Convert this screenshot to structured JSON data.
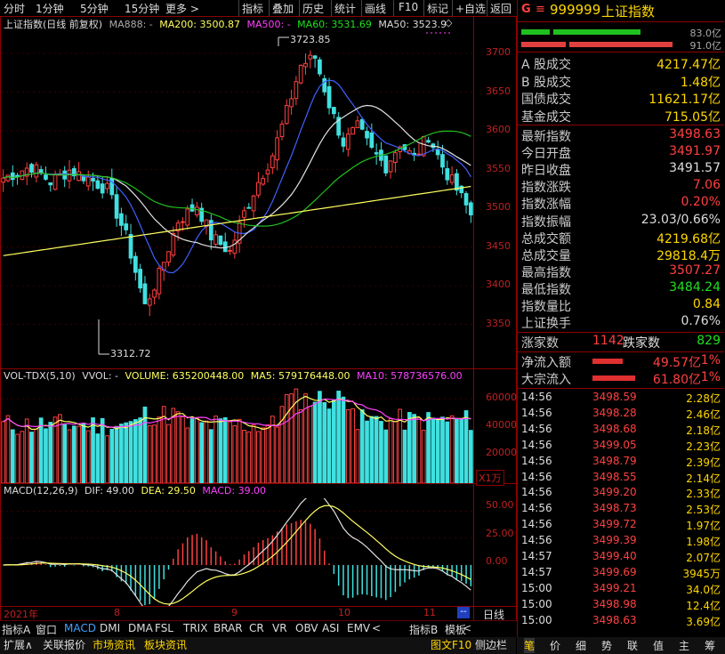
{
  "toolbar": {
    "left": [
      "分时",
      "1分钟",
      "5分钟",
      "15分钟",
      "更多 >"
    ],
    "right": [
      "指标",
      "叠加",
      "历史",
      "统计",
      "画线",
      "F10",
      "标记",
      "+自选",
      "返回"
    ]
  },
  "main_chart": {
    "legend": {
      "name": "上证指数(日线 前复权)",
      "ma888": "MA888: -",
      "ma200": "MA200: 3500.87",
      "ma500": "MA500: -",
      "ma60": "MA60: 3531.69",
      "ma50": "MA50: 3523.9"
    },
    "high_label": "3723.85",
    "low_label": "3312.72",
    "y_axis": [
      "3700",
      "3650",
      "3600",
      "3550",
      "3500",
      "3450",
      "3400",
      "3350"
    ]
  },
  "volume_chart": {
    "legend": {
      "name": "VOL-TDX(5,10)",
      "vvol": "VVOL: -",
      "volume": "VOLUME: 635200448.00",
      "ma5": "MA5: 579176448.00",
      "ma10": "MA10: 578736576.00"
    },
    "y_axis": [
      "60000",
      "40000",
      "20000"
    ],
    "unit": "X1万"
  },
  "macd_chart": {
    "legend": {
      "name": "MACD(12,26,9)",
      "dif": "DIF: 49.00",
      "dea": "DEA: 29.50",
      "macd": "MACD: 39.00"
    },
    "y_axis": [
      "50.00",
      "25.00",
      "0.00"
    ]
  },
  "x_axis": [
    "2021年",
    "8",
    "9",
    "10",
    "11"
  ],
  "x_axis_extra": "--",
  "period_label": "日线",
  "indicator_tabs": [
    "指标A",
    "窗口",
    "MACD",
    "DMI",
    "DMA",
    "FSL",
    "TRIX",
    "BRAR",
    "CR",
    "VR",
    "OBV",
    "ASI",
    "EMV",
    "<",
    "指标B",
    "模板",
    "<"
  ],
  "bottom_tabs": [
    "扩展∧",
    "关联报价",
    "市场资讯",
    "板块资讯"
  ],
  "bottom_right": [
    "图文F10",
    "侧边栏"
  ],
  "right_panel": {
    "header": {
      "badge": "G",
      "menu": "≡",
      "code": "999999",
      "name": "上证指数"
    },
    "bars": [
      "83.0亿",
      "91.0亿"
    ],
    "stats": [
      {
        "label": "A 股成交",
        "value": "4217.47亿",
        "color": "yellow"
      },
      {
        "label": "B 股成交",
        "value": "1.48亿",
        "color": "yellow"
      },
      {
        "label": "国债成交",
        "value": "11621.17亿",
        "color": "yellow"
      },
      {
        "label": "基金成交",
        "value": "715.05亿",
        "color": "yellow"
      }
    ],
    "quotes": [
      {
        "label": "最新指数",
        "value": "3498.63",
        "color": "red"
      },
      {
        "label": "今日开盘",
        "value": "3491.97",
        "color": "red"
      },
      {
        "label": "昨日收盘",
        "value": "3491.57",
        "color": "white"
      },
      {
        "label": "指数涨跌",
        "value": "7.06",
        "color": "red"
      },
      {
        "label": "指数涨幅",
        "value": "0.20%",
        "color": "red"
      },
      {
        "label": "指数振幅",
        "value": "23.03/0.66%",
        "color": "white"
      },
      {
        "label": "总成交额",
        "value": "4219.68亿",
        "color": "yellow"
      },
      {
        "label": "总成交量",
        "value": "29818.4万",
        "color": "yellow"
      },
      {
        "label": "最高指数",
        "value": "3507.27",
        "color": "red"
      },
      {
        "label": "最低指数",
        "value": "3484.24",
        "color": "green"
      },
      {
        "label": "指数量比",
        "value": "0.84",
        "color": "yellow"
      },
      {
        "label": "上证换手",
        "value": "0.76%",
        "color": "white"
      }
    ],
    "breadth": {
      "up_label": "涨家数",
      "up": "1142",
      "down_label": "跌家数",
      "down": "829"
    },
    "flows": [
      {
        "label": "净流入额",
        "value": "49.57亿",
        "pct": "1%"
      },
      {
        "label": "大宗流入",
        "value": "61.80亿",
        "pct": "1%"
      }
    ],
    "ticks": [
      {
        "time": "14:56",
        "price": "3498.59",
        "vol": "2.28亿"
      },
      {
        "time": "14:56",
        "price": "3498.28",
        "vol": "2.46亿"
      },
      {
        "time": "14:56",
        "price": "3498.68",
        "vol": "2.18亿"
      },
      {
        "time": "14:56",
        "price": "3499.05",
        "vol": "2.23亿"
      },
      {
        "time": "14:56",
        "price": "3498.79",
        "vol": "2.39亿"
      },
      {
        "time": "14:56",
        "price": "3498.55",
        "vol": "2.14亿"
      },
      {
        "time": "14:56",
        "price": "3499.20",
        "vol": "2.33亿"
      },
      {
        "time": "14:56",
        "price": "3498.73",
        "vol": "2.53亿"
      },
      {
        "time": "14:56",
        "price": "3499.72",
        "vol": "1.97亿"
      },
      {
        "time": "14:56",
        "price": "3499.39",
        "vol": "1.98亿"
      },
      {
        "time": "14:57",
        "price": "3499.40",
        "vol": "2.07亿"
      },
      {
        "time": "14:57",
        "price": "3499.69",
        "vol": "3945万"
      },
      {
        "time": "15:00",
        "price": "3499.21",
        "vol": "34.0亿"
      },
      {
        "time": "15:00",
        "price": "3498.98",
        "vol": "12.4亿"
      },
      {
        "time": "15:00",
        "price": "3498.63",
        "vol": "3.69亿"
      }
    ],
    "tabs": [
      "笔",
      "价",
      "细",
      "势",
      "联",
      "值",
      "主",
      "筹"
    ]
  },
  "colors": {
    "up": "#ff4040",
    "down": "#40e0e0",
    "ma_white": "#e0e0e0",
    "ma_yellow": "#ffff60",
    "ma_green": "#20c020",
    "ma_blue": "#4060ff",
    "border": "#8b0000"
  }
}
